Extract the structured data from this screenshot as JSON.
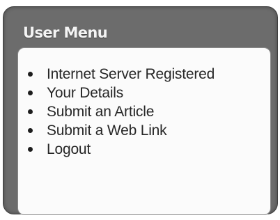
{
  "user_menu": {
    "title": "User Menu",
    "items": [
      {
        "label": "Internet Server Registered"
      },
      {
        "label": "Your Details"
      },
      {
        "label": "Submit an Article"
      },
      {
        "label": "Submit a Web Link"
      },
      {
        "label": "Logout"
      }
    ]
  },
  "colors": {
    "frame": "#6c6c6c",
    "body": "#fbfbfb",
    "title_text": "#f4f4f4",
    "link_text": "#262626"
  }
}
